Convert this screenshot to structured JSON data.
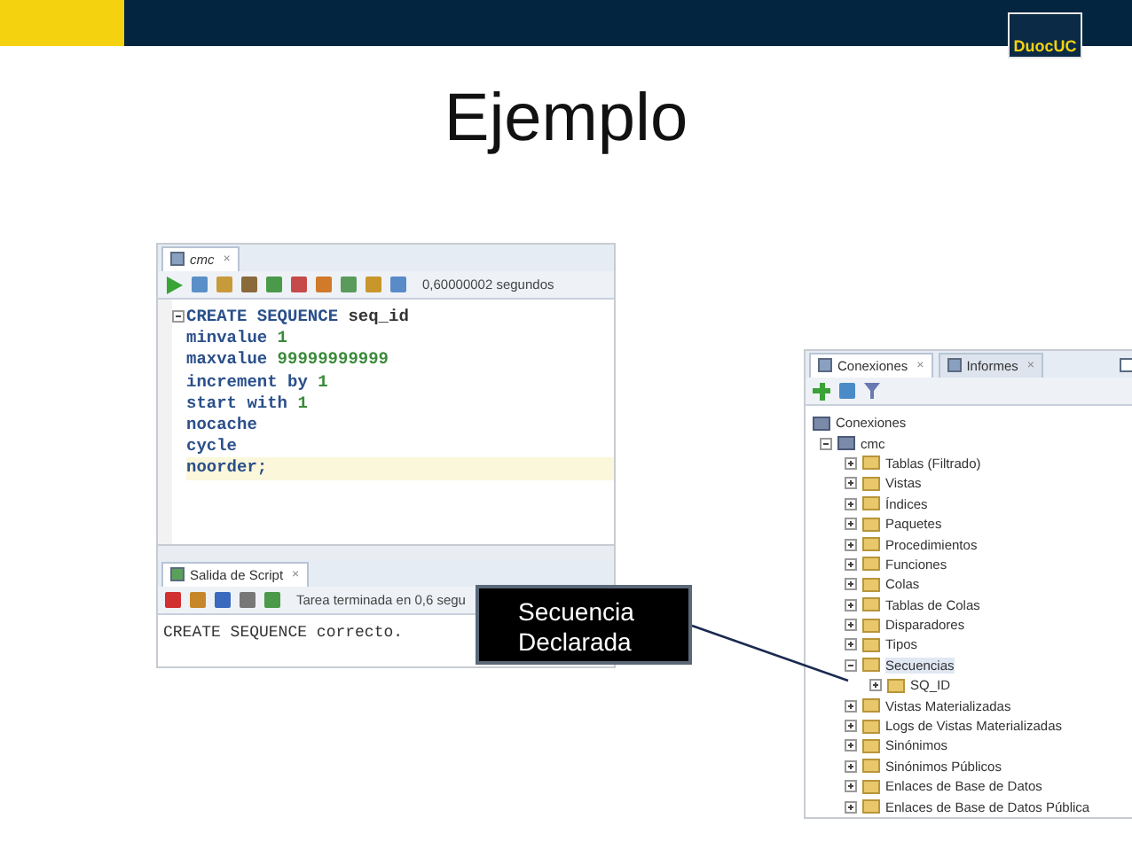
{
  "slide": {
    "title": "Ejemplo",
    "logo_text": "DuocUC"
  },
  "editor": {
    "tab": {
      "label": "cmc",
      "close": "×",
      "selected": true
    },
    "timing": "0,60000002 segundos",
    "lines": [
      {
        "highlighted": false,
        "tokens": [
          {
            "kind": "keyword",
            "text": "CREATE SEQUENCE"
          },
          {
            "kind": "ident",
            "text": "seq_id"
          }
        ]
      },
      {
        "highlighted": false,
        "tokens": [
          {
            "kind": "keyword",
            "text": "minvalue"
          },
          {
            "kind": "number",
            "text": "1"
          }
        ]
      },
      {
        "highlighted": false,
        "tokens": [
          {
            "kind": "keyword",
            "text": "maxvalue"
          },
          {
            "kind": "number",
            "text": "99999999999"
          }
        ]
      },
      {
        "highlighted": false,
        "tokens": [
          {
            "kind": "keyword",
            "text": "increment by"
          },
          {
            "kind": "number",
            "text": "1"
          }
        ]
      },
      {
        "highlighted": false,
        "tokens": [
          {
            "kind": "keyword",
            "text": "start with"
          },
          {
            "kind": "number",
            "text": "1"
          }
        ]
      },
      {
        "highlighted": false,
        "tokens": [
          {
            "kind": "keyword",
            "text": "nocache"
          }
        ]
      },
      {
        "highlighted": false,
        "tokens": [
          {
            "kind": "keyword",
            "text": "cycle"
          }
        ]
      },
      {
        "highlighted": true,
        "tokens": [
          {
            "kind": "keyword",
            "text": "noorder;"
          }
        ]
      }
    ]
  },
  "output": {
    "tab": {
      "label": "Salida de Script",
      "close": "×",
      "selected": true
    },
    "status": "Tarea terminada en 0,6 segu",
    "text": "CREATE SEQUENCE correcto."
  },
  "connections": {
    "tabs": [
      {
        "label": "Conexiones",
        "close": "×",
        "selected": true
      },
      {
        "label": "Informes",
        "close": "×",
        "selected": false
      }
    ],
    "tree": [
      {
        "label": "Conexiones",
        "selected": false,
        "children": [
          {
            "label": "cmc",
            "expanded": true,
            "selected": false,
            "children": [
              {
                "label": "Tablas (Filtrado)",
                "expanded": false,
                "selected": false
              },
              {
                "label": "Vistas",
                "expanded": false,
                "selected": false
              },
              {
                "label": "Índices",
                "expanded": false,
                "selected": false
              },
              {
                "label": "Paquetes",
                "expanded": false,
                "selected": false
              },
              {
                "label": "Procedimientos",
                "expanded": false,
                "selected": false
              },
              {
                "label": "Funciones",
                "expanded": false,
                "selected": false
              },
              {
                "label": "Colas",
                "expanded": false,
                "selected": false
              },
              {
                "label": "Tablas de Colas",
                "expanded": false,
                "selected": false
              },
              {
                "label": "Disparadores",
                "expanded": false,
                "selected": false
              },
              {
                "label": "Tipos",
                "expanded": false,
                "selected": false
              },
              {
                "label": "Secuencias",
                "expanded": true,
                "selected": true,
                "children": [
                  {
                    "label": "SQ_ID",
                    "expanded": false,
                    "selected": false
                  }
                ]
              },
              {
                "label": "Vistas Materializadas",
                "expanded": false,
                "selected": false
              },
              {
                "label": "Logs de Vistas Materializadas",
                "expanded": false,
                "selected": false
              },
              {
                "label": "Sinónimos",
                "expanded": false,
                "selected": false
              },
              {
                "label": "Sinónimos Públicos",
                "expanded": false,
                "selected": false
              },
              {
                "label": "Enlaces de Base de Datos",
                "expanded": false,
                "selected": false
              },
              {
                "label": "Enlaces de Base de Datos Pública",
                "expanded": false,
                "selected": false
              }
            ]
          }
        ]
      }
    ]
  },
  "callout": {
    "text": "Secuencia Declarada"
  }
}
